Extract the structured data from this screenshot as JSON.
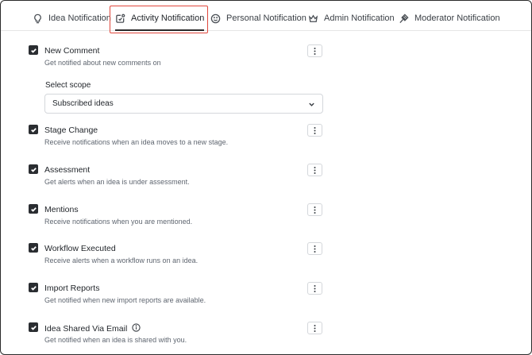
{
  "tabs": [
    {
      "label": "Idea Notification",
      "icon": "lightbulb-icon"
    },
    {
      "label": "Activity Notification",
      "icon": "activity-icon",
      "active": true
    },
    {
      "label": "Personal Notification",
      "icon": "smiley-icon"
    },
    {
      "label": "Admin Notification",
      "icon": "crown-icon"
    },
    {
      "label": "Moderator Notification",
      "icon": "gavel-icon"
    }
  ],
  "scope": {
    "label": "Select scope",
    "value": "Subscribed ideas"
  },
  "settings": [
    {
      "title": "New Comment",
      "description": "Get notified about new comments on",
      "checked": true
    },
    {
      "title": "Stage Change",
      "description": "Receive notifications when an idea moves to a new stage.",
      "checked": true
    },
    {
      "title": "Assessment",
      "description": "Get alerts when an idea is under assessment.",
      "checked": true
    },
    {
      "title": "Mentions",
      "description": "Receive notifications when you are mentioned.",
      "checked": true
    },
    {
      "title": "Workflow Executed",
      "description": "Receive alerts when a workflow runs on an idea.",
      "checked": true
    },
    {
      "title": "Import Reports",
      "description": "Get notified when new import reports are available.",
      "checked": true
    },
    {
      "title": "Idea Shared Via Email",
      "description": "Get notified when an idea is shared with you.",
      "checked": true
    }
  ],
  "colors": {
    "highlight": "#e0473c",
    "checkbox": "#2a2d31"
  }
}
